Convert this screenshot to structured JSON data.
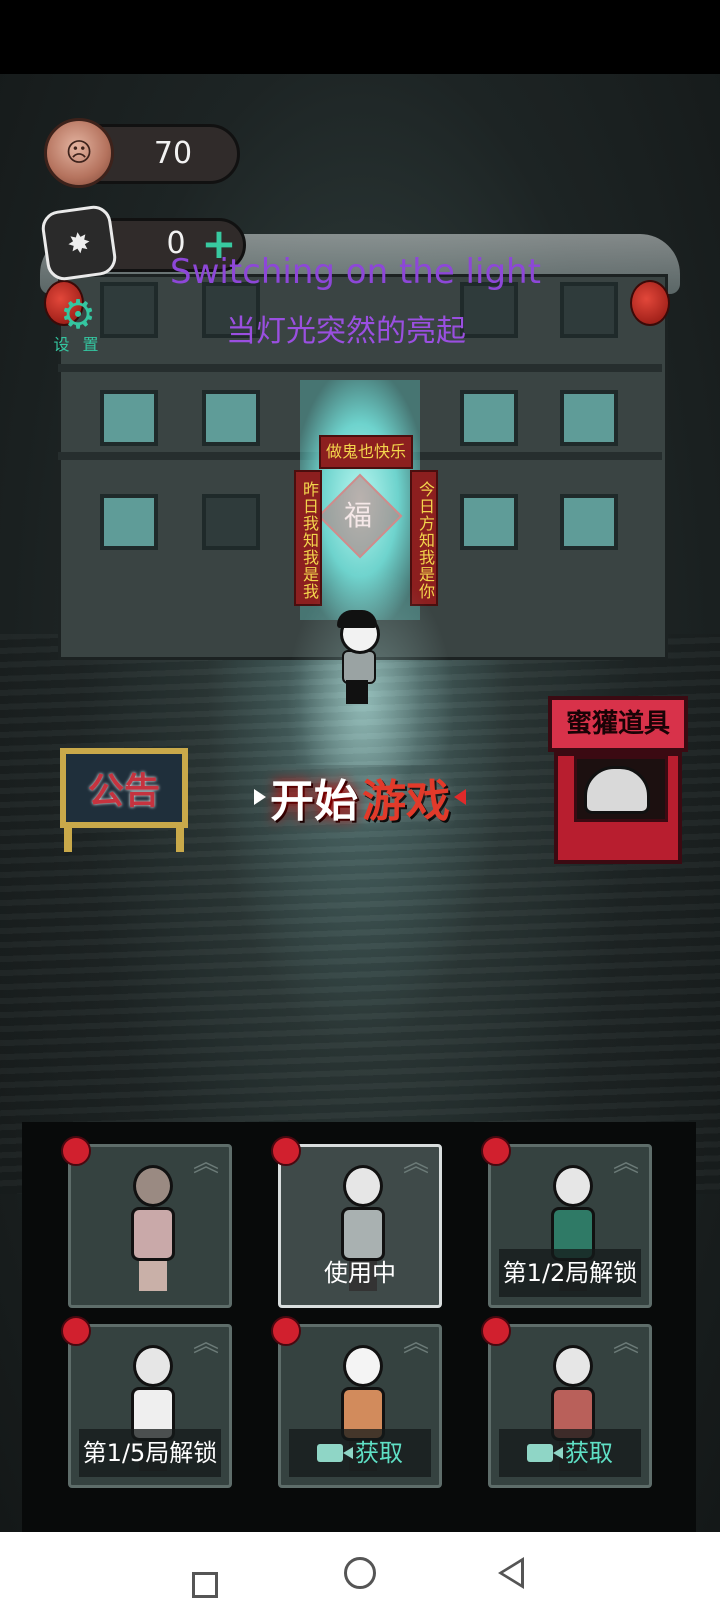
{
  "hud": {
    "coins": "70",
    "keys": "0",
    "plus_symbol": "+",
    "settings_label": "设 置"
  },
  "banner": {
    "song_title_en": "Switching on the light",
    "song_title_cn": "当灯光突然的亮起"
  },
  "building": {
    "lintel": "做鬼也快乐",
    "couplet_left": "昨日我知我是我",
    "couplet_right": "今日方知我是你",
    "door_sign": "福"
  },
  "notice_board": {
    "label": "公告"
  },
  "start_button": {
    "part1": "开始",
    "part2": "游戏"
  },
  "shop": {
    "label": "蜜獾道具"
  },
  "characters": [
    {
      "name": "girl-character",
      "label": "",
      "state": "owned"
    },
    {
      "name": "boy-glasses-character",
      "label": "使用中",
      "state": "in-use"
    },
    {
      "name": "bearded-man-character",
      "label": "第1/2局解锁",
      "state": "locked"
    },
    {
      "name": "woman-bun-character",
      "label": "第1/5局解锁",
      "state": "locked"
    },
    {
      "name": "grandma-character",
      "label": "获取",
      "state": "video"
    },
    {
      "name": "old-woman-character",
      "label": "获取",
      "state": "video"
    }
  ],
  "colors": {
    "accent_green": "#34c6a0",
    "start_red": "#e23a2a",
    "overlay_purple": "#8d47d8",
    "dot_red": "#d1202e"
  }
}
